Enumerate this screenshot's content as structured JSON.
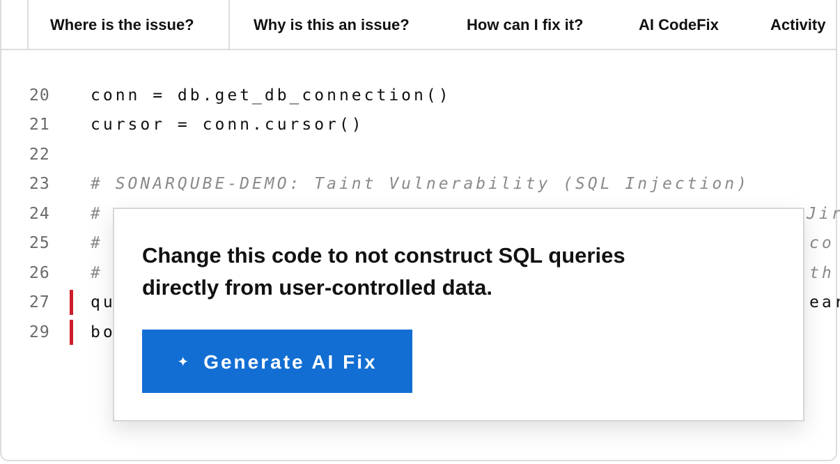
{
  "tabs": [
    {
      "label": "Where is the issue?"
    },
    {
      "label": "Why is this an issue?"
    },
    {
      "label": "How can I fix it?"
    },
    {
      "label": "AI CodeFix"
    },
    {
      "label": "Activity"
    }
  ],
  "code": {
    "lines": [
      {
        "num": "20",
        "text": "conn = db.get_db_connection()"
      },
      {
        "num": "21",
        "text": "cursor = conn.cursor()"
      },
      {
        "num": "22",
        "text": ""
      },
      {
        "num": "23",
        "text": "# SONARQUBE-DEMO: Taint Vulnerability (SQL Injection)"
      },
      {
        "num": "24",
        "text": "#",
        "tail": "Jir"
      },
      {
        "num": "25",
        "text": "#",
        "tail": "co"
      },
      {
        "num": "26",
        "text": "#",
        "tail": "th"
      },
      {
        "num": "27",
        "text": "qu",
        "tail": "ear"
      },
      {
        "num": "29",
        "text": "bo"
      }
    ]
  },
  "popup": {
    "message": "Change this code to not construct SQL queries directly from user-controlled data.",
    "button_label": "Generate AI Fix",
    "button_icon": "sparkle-icon"
  },
  "colors": {
    "accent": "#126ed3",
    "issue_marker": "#cc1f2b",
    "border": "#dcdcdc",
    "comment": "#8a8a8a"
  }
}
